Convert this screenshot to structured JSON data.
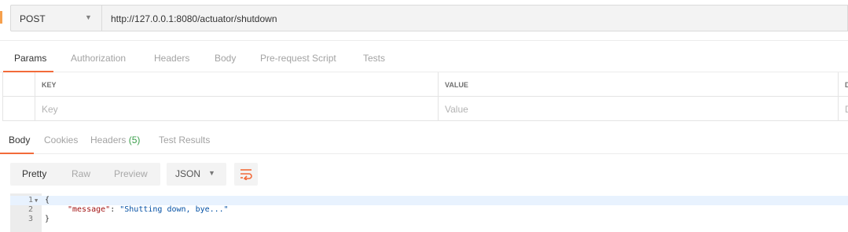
{
  "request": {
    "method": "POST",
    "url": "http://127.0.0.1:8080/actuator/shutdown",
    "tabs": [
      "Params",
      "Authorization",
      "Headers",
      "Body",
      "Pre-request Script",
      "Tests"
    ],
    "active_tab": "Params"
  },
  "params_table": {
    "columns": [
      "KEY",
      "VALUE",
      "D"
    ],
    "placeholders": {
      "key": "Key",
      "value": "Value",
      "desc": "D"
    }
  },
  "response": {
    "tabs": [
      "Body",
      "Cookies",
      "Headers",
      "Test Results"
    ],
    "headers_count": "(5)",
    "active_tab": "Body",
    "view_modes": [
      "Pretty",
      "Raw",
      "Preview"
    ],
    "active_view": "Pretty",
    "format": "JSON",
    "code_lines": [
      {
        "num": "1",
        "text": "{"
      },
      {
        "num": "2",
        "key": "\"message\"",
        "sep": ": ",
        "value": "\"Shutting down, bye...\""
      },
      {
        "num": "3",
        "text": "}"
      }
    ]
  },
  "icons": {
    "method_caret": "chevron-down-icon",
    "format_caret": "chevron-down-icon",
    "wrap": "wrap-lines-icon",
    "fold": "fold-caret-icon"
  },
  "colors": {
    "accent": "#f26b3a",
    "count_green": "#3b9f4b",
    "json_key": "#a31515",
    "json_string": "#0451a5"
  }
}
